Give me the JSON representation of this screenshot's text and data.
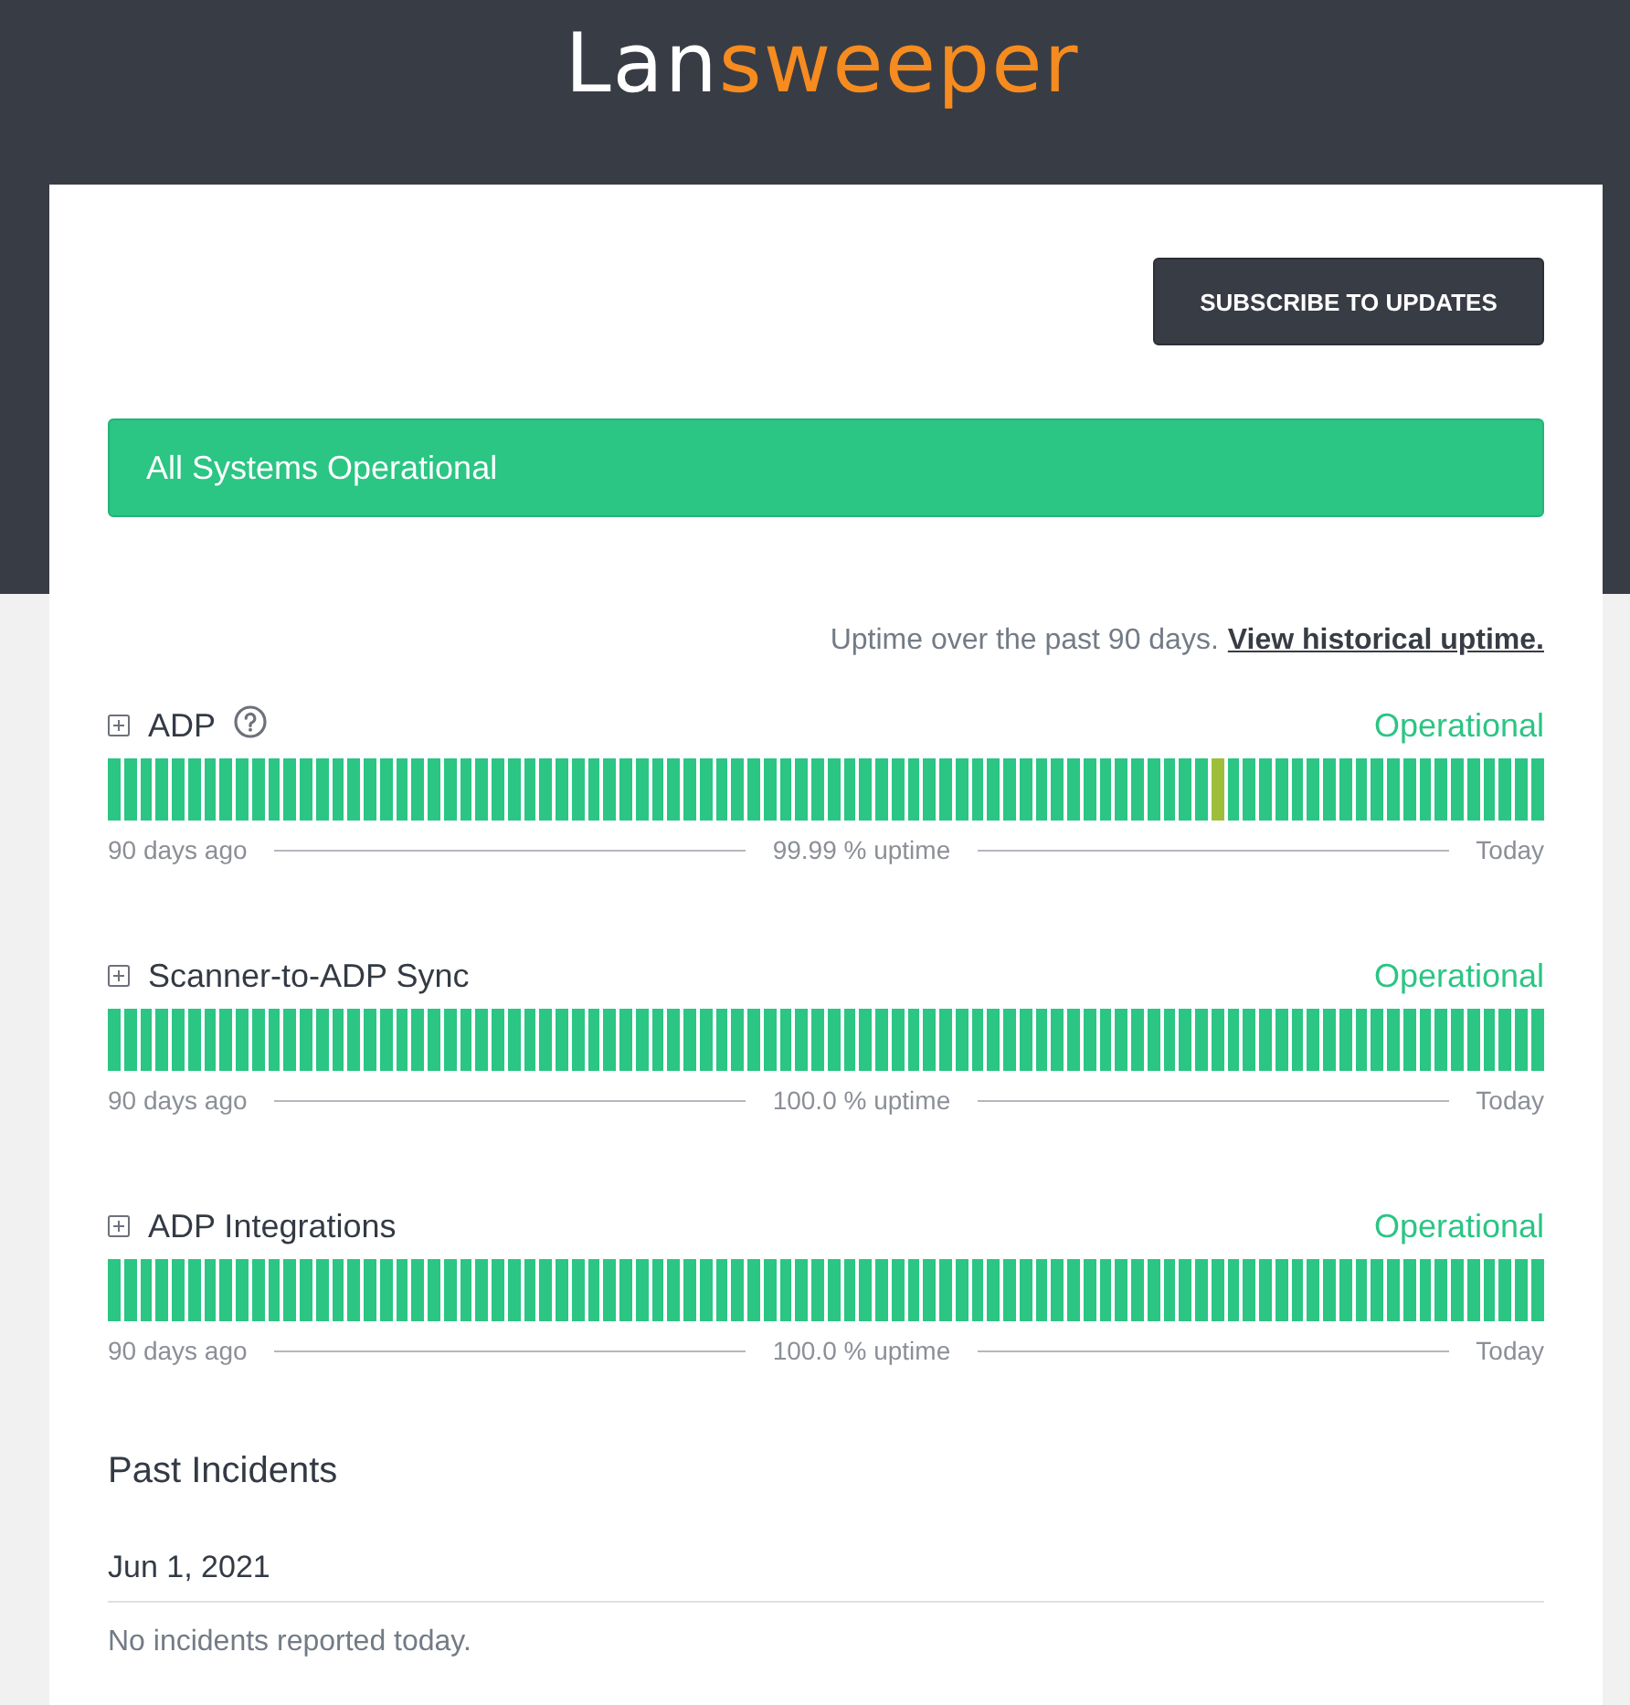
{
  "header": {
    "logo": {
      "part_1": "Lan",
      "part_2": "sweeper"
    }
  },
  "subscribe_button": {
    "label": "SUBSCRIBE TO UPDATES"
  },
  "status_banner": {
    "text": "All Systems Operational"
  },
  "uptime_note": {
    "text": "Uptime over the past 90 days.",
    "link": "View historical uptime."
  },
  "components": [
    {
      "name": "ADP",
      "info_icon": true,
      "status": "Operational",
      "days": [
        {
          "color": "#2bc584"
        },
        {
          "color": "#2bc584"
        },
        {
          "color": "#2bc584"
        },
        {
          "color": "#2bc584"
        },
        {
          "color": "#2bc584"
        },
        {
          "color": "#2bc584"
        },
        {
          "color": "#2bc584"
        },
        {
          "color": "#2bc584"
        },
        {
          "color": "#2bc584"
        },
        {
          "color": "#2bc584"
        },
        {
          "color": "#2bc584"
        },
        {
          "color": "#2bc584"
        },
        {
          "color": "#2bc584"
        },
        {
          "color": "#2bc584"
        },
        {
          "color": "#2bc584"
        },
        {
          "color": "#2bc584"
        },
        {
          "color": "#2bc584"
        },
        {
          "color": "#2bc584"
        },
        {
          "color": "#2bc584"
        },
        {
          "color": "#2bc584"
        },
        {
          "color": "#2bc584"
        },
        {
          "color": "#2bc584"
        },
        {
          "color": "#2bc584"
        },
        {
          "color": "#2bc584"
        },
        {
          "color": "#2bc584"
        },
        {
          "color": "#2bc584"
        },
        {
          "color": "#2bc584"
        },
        {
          "color": "#2bc584"
        },
        {
          "color": "#2bc584"
        },
        {
          "color": "#2bc584"
        },
        {
          "color": "#2bc584"
        },
        {
          "color": "#2bc584"
        },
        {
          "color": "#2bc584"
        },
        {
          "color": "#2bc584"
        },
        {
          "color": "#2bc584"
        },
        {
          "color": "#2bc584"
        },
        {
          "color": "#2bc584"
        },
        {
          "color": "#2bc584"
        },
        {
          "color": "#2bc584"
        },
        {
          "color": "#2bc584"
        },
        {
          "color": "#2bc584"
        },
        {
          "color": "#2bc584"
        },
        {
          "color": "#2bc584"
        },
        {
          "color": "#2bc584"
        },
        {
          "color": "#2bc584"
        },
        {
          "color": "#2bc584"
        },
        {
          "color": "#2bc584"
        },
        {
          "color": "#2bc584"
        },
        {
          "color": "#2bc584"
        },
        {
          "color": "#2bc584"
        },
        {
          "color": "#2bc584"
        },
        {
          "color": "#2bc584"
        },
        {
          "color": "#2bc584"
        },
        {
          "color": "#2bc584"
        },
        {
          "color": "#2bc584"
        },
        {
          "color": "#2bc584"
        },
        {
          "color": "#2bc584"
        },
        {
          "color": "#2bc584"
        },
        {
          "color": "#2bc584"
        },
        {
          "color": "#2bc584"
        },
        {
          "color": "#2bc584"
        },
        {
          "color": "#2bc584"
        },
        {
          "color": "#2bc584"
        },
        {
          "color": "#2bc584"
        },
        {
          "color": "#2bc584"
        },
        {
          "color": "#2bc584"
        },
        {
          "color": "#2bc584"
        },
        {
          "color": "#2bc584"
        },
        {
          "color": "#2bc584"
        },
        {
          "color": "#9ebe3a"
        },
        {
          "color": "#2bc584"
        },
        {
          "color": "#2bc584"
        },
        {
          "color": "#2bc584"
        },
        {
          "color": "#2bc584"
        },
        {
          "color": "#2bc584"
        },
        {
          "color": "#2bc584"
        },
        {
          "color": "#2bc584"
        },
        {
          "color": "#2bc584"
        },
        {
          "color": "#2bc584"
        },
        {
          "color": "#2bc584"
        },
        {
          "color": "#2bc584"
        },
        {
          "color": "#2bc584"
        },
        {
          "color": "#2bc584"
        },
        {
          "color": "#2bc584"
        },
        {
          "color": "#2bc584"
        },
        {
          "color": "#2bc584"
        },
        {
          "color": "#2bc584"
        },
        {
          "color": "#2bc584"
        },
        {
          "color": "#2bc584"
        },
        {
          "color": "#2bc584"
        }
      ],
      "range_start": "90 days ago",
      "uptime": "99.99 % uptime",
      "range_end": "Today"
    },
    {
      "name": "Scanner-to-ADP Sync",
      "info_icon": false,
      "status": "Operational",
      "days": [
        {
          "color": "#2bc584"
        },
        {
          "color": "#2bc584"
        },
        {
          "color": "#2bc584"
        },
        {
          "color": "#2bc584"
        },
        {
          "color": "#2bc584"
        },
        {
          "color": "#2bc584"
        },
        {
          "color": "#2bc584"
        },
        {
          "color": "#2bc584"
        },
        {
          "color": "#2bc584"
        },
        {
          "color": "#2bc584"
        },
        {
          "color": "#2bc584"
        },
        {
          "color": "#2bc584"
        },
        {
          "color": "#2bc584"
        },
        {
          "color": "#2bc584"
        },
        {
          "color": "#2bc584"
        },
        {
          "color": "#2bc584"
        },
        {
          "color": "#2bc584"
        },
        {
          "color": "#2bc584"
        },
        {
          "color": "#2bc584"
        },
        {
          "color": "#2bc584"
        },
        {
          "color": "#2bc584"
        },
        {
          "color": "#2bc584"
        },
        {
          "color": "#2bc584"
        },
        {
          "color": "#2bc584"
        },
        {
          "color": "#2bc584"
        },
        {
          "color": "#2bc584"
        },
        {
          "color": "#2bc584"
        },
        {
          "color": "#2bc584"
        },
        {
          "color": "#2bc584"
        },
        {
          "color": "#2bc584"
        },
        {
          "color": "#2bc584"
        },
        {
          "color": "#2bc584"
        },
        {
          "color": "#2bc584"
        },
        {
          "color": "#2bc584"
        },
        {
          "color": "#2bc584"
        },
        {
          "color": "#2bc584"
        },
        {
          "color": "#2bc584"
        },
        {
          "color": "#2bc584"
        },
        {
          "color": "#2bc584"
        },
        {
          "color": "#2bc584"
        },
        {
          "color": "#2bc584"
        },
        {
          "color": "#2bc584"
        },
        {
          "color": "#2bc584"
        },
        {
          "color": "#2bc584"
        },
        {
          "color": "#2bc584"
        },
        {
          "color": "#2bc584"
        },
        {
          "color": "#2bc584"
        },
        {
          "color": "#2bc584"
        },
        {
          "color": "#2bc584"
        },
        {
          "color": "#2bc584"
        },
        {
          "color": "#2bc584"
        },
        {
          "color": "#2bc584"
        },
        {
          "color": "#2bc584"
        },
        {
          "color": "#2bc584"
        },
        {
          "color": "#2bc584"
        },
        {
          "color": "#2bc584"
        },
        {
          "color": "#2bc584"
        },
        {
          "color": "#2bc584"
        },
        {
          "color": "#2bc584"
        },
        {
          "color": "#2bc584"
        },
        {
          "color": "#2bc584"
        },
        {
          "color": "#2bc584"
        },
        {
          "color": "#2bc584"
        },
        {
          "color": "#2bc584"
        },
        {
          "color": "#2bc584"
        },
        {
          "color": "#2bc584"
        },
        {
          "color": "#2bc584"
        },
        {
          "color": "#2bc584"
        },
        {
          "color": "#2bc584"
        },
        {
          "color": "#2bc584"
        },
        {
          "color": "#2bc584"
        },
        {
          "color": "#2bc584"
        },
        {
          "color": "#2bc584"
        },
        {
          "color": "#2bc584"
        },
        {
          "color": "#2bc584"
        },
        {
          "color": "#2bc584"
        },
        {
          "color": "#2bc584"
        },
        {
          "color": "#2bc584"
        },
        {
          "color": "#2bc584"
        },
        {
          "color": "#2bc584"
        },
        {
          "color": "#2bc584"
        },
        {
          "color": "#2bc584"
        },
        {
          "color": "#2bc584"
        },
        {
          "color": "#2bc584"
        },
        {
          "color": "#2bc584"
        },
        {
          "color": "#2bc584"
        },
        {
          "color": "#2bc584"
        },
        {
          "color": "#2bc584"
        },
        {
          "color": "#2bc584"
        },
        {
          "color": "#2bc584"
        }
      ],
      "range_start": "90 days ago",
      "uptime": "100.0 % uptime",
      "range_end": "Today"
    },
    {
      "name": "ADP Integrations",
      "info_icon": false,
      "status": "Operational",
      "days": [
        {
          "color": "#2bc584"
        },
        {
          "color": "#2bc584"
        },
        {
          "color": "#2bc584"
        },
        {
          "color": "#2bc584"
        },
        {
          "color": "#2bc584"
        },
        {
          "color": "#2bc584"
        },
        {
          "color": "#2bc584"
        },
        {
          "color": "#2bc584"
        },
        {
          "color": "#2bc584"
        },
        {
          "color": "#2bc584"
        },
        {
          "color": "#2bc584"
        },
        {
          "color": "#2bc584"
        },
        {
          "color": "#2bc584"
        },
        {
          "color": "#2bc584"
        },
        {
          "color": "#2bc584"
        },
        {
          "color": "#2bc584"
        },
        {
          "color": "#2bc584"
        },
        {
          "color": "#2bc584"
        },
        {
          "color": "#2bc584"
        },
        {
          "color": "#2bc584"
        },
        {
          "color": "#2bc584"
        },
        {
          "color": "#2bc584"
        },
        {
          "color": "#2bc584"
        },
        {
          "color": "#2bc584"
        },
        {
          "color": "#2bc584"
        },
        {
          "color": "#2bc584"
        },
        {
          "color": "#2bc584"
        },
        {
          "color": "#2bc584"
        },
        {
          "color": "#2bc584"
        },
        {
          "color": "#2bc584"
        },
        {
          "color": "#2bc584"
        },
        {
          "color": "#2bc584"
        },
        {
          "color": "#2bc584"
        },
        {
          "color": "#2bc584"
        },
        {
          "color": "#2bc584"
        },
        {
          "color": "#2bc584"
        },
        {
          "color": "#2bc584"
        },
        {
          "color": "#2bc584"
        },
        {
          "color": "#2bc584"
        },
        {
          "color": "#2bc584"
        },
        {
          "color": "#2bc584"
        },
        {
          "color": "#2bc584"
        },
        {
          "color": "#2bc584"
        },
        {
          "color": "#2bc584"
        },
        {
          "color": "#2bc584"
        },
        {
          "color": "#2bc584"
        },
        {
          "color": "#2bc584"
        },
        {
          "color": "#2bc584"
        },
        {
          "color": "#2bc584"
        },
        {
          "color": "#2bc584"
        },
        {
          "color": "#2bc584"
        },
        {
          "color": "#2bc584"
        },
        {
          "color": "#2bc584"
        },
        {
          "color": "#2bc584"
        },
        {
          "color": "#2bc584"
        },
        {
          "color": "#2bc584"
        },
        {
          "color": "#2bc584"
        },
        {
          "color": "#2bc584"
        },
        {
          "color": "#2bc584"
        },
        {
          "color": "#2bc584"
        },
        {
          "color": "#2bc584"
        },
        {
          "color": "#2bc584"
        },
        {
          "color": "#2bc584"
        },
        {
          "color": "#2bc584"
        },
        {
          "color": "#2bc584"
        },
        {
          "color": "#2bc584"
        },
        {
          "color": "#2bc584"
        },
        {
          "color": "#2bc584"
        },
        {
          "color": "#2bc584"
        },
        {
          "color": "#2bc584"
        },
        {
          "color": "#2bc584"
        },
        {
          "color": "#2bc584"
        },
        {
          "color": "#2bc584"
        },
        {
          "color": "#2bc584"
        },
        {
          "color": "#2bc584"
        },
        {
          "color": "#2bc584"
        },
        {
          "color": "#2bc584"
        },
        {
          "color": "#2bc584"
        },
        {
          "color": "#2bc584"
        },
        {
          "color": "#2bc584"
        },
        {
          "color": "#2bc584"
        },
        {
          "color": "#2bc584"
        },
        {
          "color": "#2bc584"
        },
        {
          "color": "#2bc584"
        },
        {
          "color": "#2bc584"
        },
        {
          "color": "#2bc584"
        },
        {
          "color": "#2bc584"
        },
        {
          "color": "#2bc584"
        },
        {
          "color": "#2bc584"
        },
        {
          "color": "#2bc584"
        }
      ],
      "range_start": "90 days ago",
      "uptime": "100.0 % uptime",
      "range_end": "Today"
    }
  ],
  "past_incidents": {
    "title": "Past Incidents",
    "days": [
      {
        "date": "Jun 1, 2021",
        "message": "No incidents reported today."
      }
    ]
  }
}
